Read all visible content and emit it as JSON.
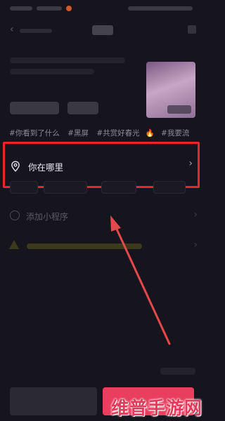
{
  "hashtags": [
    "#你看到了什么",
    "#黑屏",
    "#共赏好春光",
    "#我要流"
  ],
  "location": {
    "label": "你在哪里",
    "icon": "location-pin-icon"
  },
  "mini_program": {
    "label": "添加小程序",
    "icon": "link-icon"
  },
  "watermark": "维普手游网",
  "colors": {
    "highlight_box": "#e8272d",
    "arrow": "#e3484a",
    "publish_button": "#e93e5d",
    "fire": "#ff6a2a"
  }
}
